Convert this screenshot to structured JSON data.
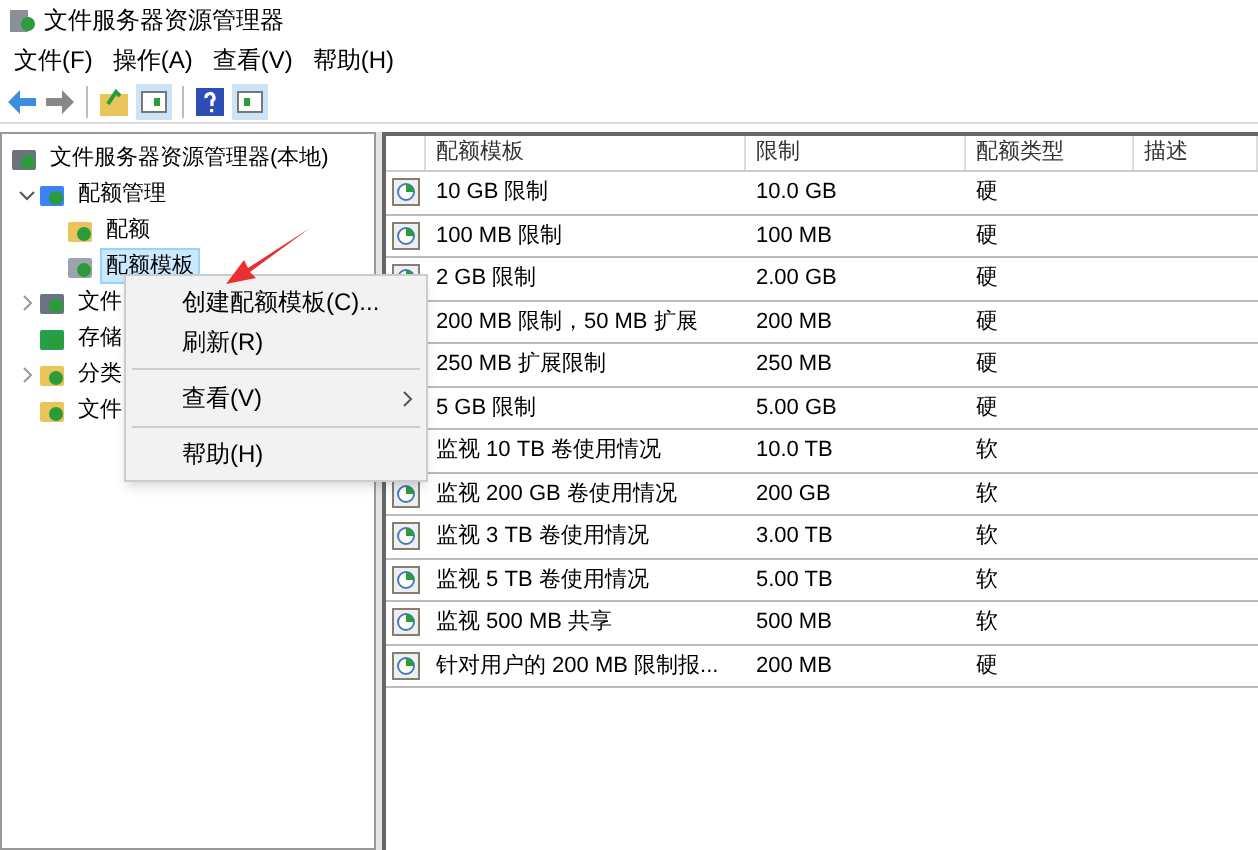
{
  "window": {
    "title": "文件服务器资源管理器"
  },
  "menu_bar": [
    "文件(F)",
    "操作(A)",
    "查看(V)",
    "帮助(H)"
  ],
  "tree": [
    {
      "label": "文件服务器资源管理器(本地)",
      "kind": "server",
      "children": [
        {
          "label": "配额管理",
          "kind": "quota",
          "expanded": true,
          "selected": false,
          "children": [
            {
              "label": "配额",
              "kind": "folder",
              "selected": false
            },
            {
              "label": "配额模板",
              "kind": "template",
              "selected": true
            }
          ]
        },
        {
          "label": "文件",
          "kind": "screen",
          "expanded": false,
          "selected": false
        },
        {
          "label": "存储",
          "kind": "report",
          "selected": false
        },
        {
          "label": "分类",
          "kind": "folder",
          "expanded": false,
          "selected": false
        },
        {
          "label": "文件",
          "kind": "folder",
          "selected": false
        }
      ]
    }
  ],
  "table": {
    "columns": [
      "配额模板",
      "限制",
      "配额类型",
      "描述"
    ],
    "rows": [
      {
        "name": "10 GB 限制",
        "limit": "10.0 GB",
        "type": "硬"
      },
      {
        "name": "100 MB 限制",
        "limit": "100 MB",
        "type": "硬"
      },
      {
        "name": "2 GB 限制",
        "limit": "2.00 GB",
        "type": "硬"
      },
      {
        "name": "200 MB 限制，50 MB 扩展",
        "limit": "200 MB",
        "type": "硬"
      },
      {
        "name": "250 MB 扩展限制",
        "limit": "250 MB",
        "type": "硬"
      },
      {
        "name": "5 GB 限制",
        "limit": "5.00 GB",
        "type": "硬"
      },
      {
        "name": "监视 10 TB 卷使用情况",
        "limit": "10.0 TB",
        "type": "软"
      },
      {
        "name": "监视 200 GB 卷使用情况",
        "limit": "200 GB",
        "type": "软"
      },
      {
        "name": "监视 3 TB 卷使用情况",
        "limit": "3.00 TB",
        "type": "软"
      },
      {
        "name": "监视 5 TB 卷使用情况",
        "limit": "5.00 TB",
        "type": "软"
      },
      {
        "name": "监视 500 MB 共享",
        "limit": "500 MB",
        "type": "软"
      },
      {
        "name": "针对用户的 200 MB 限制报...",
        "limit": "200 MB",
        "type": "硬"
      }
    ]
  },
  "context_menu": [
    {
      "label": "创建配额模板(C)...",
      "kind": "item"
    },
    {
      "label": "刷新(R)",
      "kind": "item"
    },
    {
      "kind": "separator"
    },
    {
      "label": "查看(V)",
      "kind": "submenu"
    },
    {
      "kind": "separator"
    },
    {
      "label": "帮助(H)",
      "kind": "item"
    }
  ]
}
